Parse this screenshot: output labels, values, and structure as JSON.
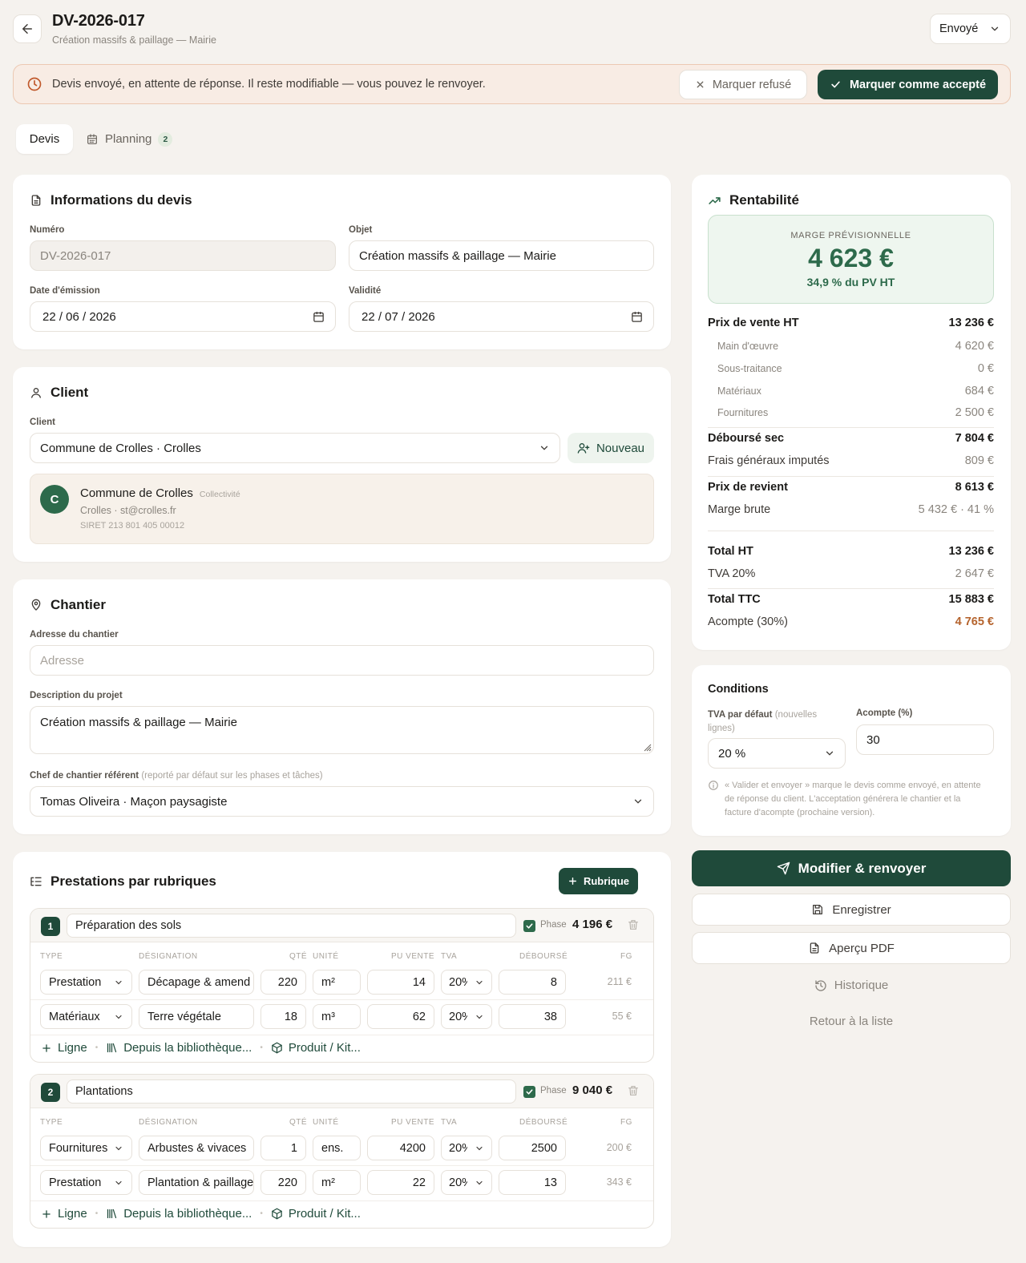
{
  "header": {
    "title": "DV-2026-017",
    "subtitle": "Création massifs & paillage — Mairie",
    "status": "Envoyé"
  },
  "banner": {
    "text": "Devis envoyé, en attente de réponse. Il reste modifiable — vous pouvez le renvoyer.",
    "refuse_label": "Marquer refusé",
    "accept_label": "Marquer comme accepté"
  },
  "tabs": [
    {
      "label": "Devis"
    },
    {
      "label": "Planning",
      "badge": "2"
    }
  ],
  "info": {
    "title": "Informations du devis",
    "numero_label": "Numéro",
    "numero": "DV-2026-017",
    "objet_label": "Objet",
    "objet": "Création massifs & paillage — Mairie",
    "date_label": "Date d'émission",
    "date": "22 / 06 / 2026",
    "validite_label": "Validité",
    "validite": "22 / 07 / 2026"
  },
  "client": {
    "title": "Client",
    "field_label": "Client",
    "selected": "Commune de Crolles · Crolles",
    "new_label": "Nouveau",
    "avatar": "C",
    "name": "Commune de Crolles",
    "type": "Collectivité",
    "contact": "Crolles · st@crolles.fr",
    "siret": "SIRET 213 801 405 00012"
  },
  "chantier": {
    "title": "Chantier",
    "adresse_label": "Adresse du chantier",
    "adresse_placeholder": "Adresse",
    "desc_label": "Description du projet",
    "desc": "Création massifs & paillage — Mairie",
    "chef_label": "Chef de chantier référent",
    "chef_hint": "(reporté par défaut sur les phases et tâches)",
    "chef": "Tomas Oliveira · Maçon paysagiste"
  },
  "prestations": {
    "title": "Prestations par rubriques",
    "add_label": "Rubrique",
    "columns": [
      "TYPE",
      "DÉSIGNATION",
      "QTÉ",
      "UNITÉ",
      "PU VENTE",
      "TVA",
      "DÉBOURSÉ",
      "FG"
    ],
    "phase_label": "Phase",
    "foot_line": "Ligne",
    "foot_lib": "Depuis la bibliothèque...",
    "foot_kit": "Produit / Kit...",
    "rubriques": [
      {
        "num": "1",
        "name": "Préparation des sols",
        "total": "4 196 €",
        "lines": [
          {
            "type": "Prestation",
            "designation": "Décapage & amend",
            "qte": "220",
            "unite": "m²",
            "pu": "14",
            "tva": "20%",
            "debourse": "8",
            "fg": "211 €"
          },
          {
            "type": "Matériaux",
            "designation": "Terre végétale",
            "qte": "18",
            "unite": "m³",
            "pu": "62",
            "tva": "20%",
            "debourse": "38",
            "fg": "55 €"
          }
        ]
      },
      {
        "num": "2",
        "name": "Plantations",
        "total": "9 040 €",
        "lines": [
          {
            "type": "Fournitures",
            "designation": "Arbustes & vivaces",
            "qte": "1",
            "unite": "ens.",
            "pu": "4200",
            "tva": "20%",
            "debourse": "2500",
            "fg": "200 €"
          },
          {
            "type": "Prestation",
            "designation": "Plantation & paillage",
            "qte": "220",
            "unite": "m²",
            "pu": "22",
            "tva": "20%",
            "debourse": "13",
            "fg": "343 €"
          }
        ]
      }
    ]
  },
  "rentabilite": {
    "title": "Rentabilité",
    "marge_label": "MARGE PRÉVISIONNELLE",
    "marge_value": "4 623 €",
    "marge_pct": "34,9 % du PV HT",
    "rows": {
      "pv": {
        "label": "Prix de vente HT",
        "value": "13 236 €"
      },
      "mo": {
        "label": "Main d'œuvre",
        "value": "4 620 €"
      },
      "st": {
        "label": "Sous-traitance",
        "value": "0 €"
      },
      "mat": {
        "label": "Matériaux",
        "value": "684 €"
      },
      "four": {
        "label": "Fournitures",
        "value": "2 500 €"
      },
      "ds": {
        "label": "Déboursé sec",
        "value": "7 804 €"
      },
      "fg": {
        "label": "Frais généraux imputés",
        "value": "809 €"
      },
      "pr": {
        "label": "Prix de revient",
        "value": "8 613 €"
      },
      "mb": {
        "label": "Marge brute",
        "value": "5 432 € · 41 %"
      },
      "tht": {
        "label": "Total HT",
        "value": "13 236 €"
      },
      "tva": {
        "label": "TVA 20%",
        "value": "2 647 €"
      },
      "ttc": {
        "label": "Total TTC",
        "value": "15 883 €"
      },
      "acompte": {
        "label": "Acompte (30%)",
        "value": "4 765 €"
      }
    }
  },
  "conditions": {
    "title": "Conditions",
    "tva_label": "TVA par défaut",
    "tva_hint": "(nouvelles lignes)",
    "tva_value": "20 %",
    "acompte_label": "Acompte (%)",
    "acompte_value": "30",
    "note": "« Valider et envoyer » marque le devis comme envoyé, en attente de réponse du client. L'acceptation générera le chantier et la facture d'acompte (prochaine version)."
  },
  "actions": {
    "primary": "Modifier & renvoyer",
    "save": "Enregistrer",
    "pdf": "Aperçu PDF",
    "history": "Historique",
    "back": "Retour à la liste"
  },
  "colors": {
    "accent": "#1f4a3a",
    "positive": "#2d6a4b",
    "warning_bg": "#f8ece4",
    "acompte": "#b5642e"
  }
}
